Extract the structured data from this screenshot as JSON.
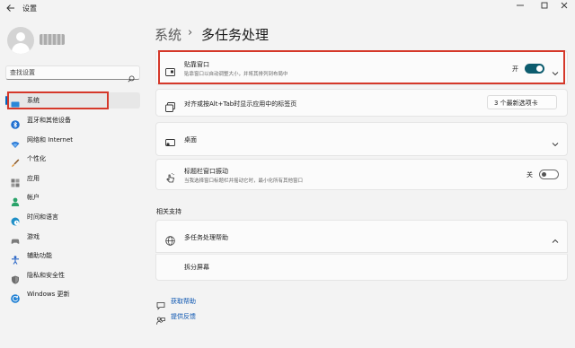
{
  "window": {
    "title": "设置",
    "back_icon": "back-arrow-icon",
    "controls": [
      "minimize-icon",
      "maximize-icon",
      "close-icon"
    ]
  },
  "search": {
    "placeholder": "查找设置"
  },
  "sidebar": {
    "items": [
      {
        "label": "系统",
        "icon": "system-icon",
        "active": true
      },
      {
        "label": "蓝牙和其他设备",
        "icon": "bluetooth-icon"
      },
      {
        "label": "网络和 Internet",
        "icon": "wifi-icon"
      },
      {
        "label": "个性化",
        "icon": "brush-icon"
      },
      {
        "label": "应用",
        "icon": "apps-icon"
      },
      {
        "label": "帐户",
        "icon": "account-icon"
      },
      {
        "label": "时间和语言",
        "icon": "globe-clock-icon"
      },
      {
        "label": "游戏",
        "icon": "gamepad-icon"
      },
      {
        "label": "辅助功能",
        "icon": "accessibility-icon"
      },
      {
        "label": "隐私和安全性",
        "icon": "shield-icon"
      },
      {
        "label": "Windows 更新",
        "icon": "update-icon"
      }
    ]
  },
  "breadcrumb": {
    "parent": "系统",
    "separator": "›",
    "current": "多任务处理"
  },
  "cards": {
    "snap": {
      "title": "贴靠窗口",
      "desc": "贴靠窗口以自动调整大小，并将其排列到布局中",
      "toggle_label": "开",
      "toggle_on": true
    },
    "alt_tab": {
      "title": "对齐或按Alt+Tab时显示应用中的标签页",
      "select_value": "3 个最新选项卡"
    },
    "desktops": {
      "title": "桌面"
    },
    "shake": {
      "title": "标题栏窗口振动",
      "desc": "当我选择窗口标题栏并摇动它时，最小化所有其他窗口",
      "toggle_label": "关",
      "toggle_on": false
    }
  },
  "related": {
    "section_title": "相关支持",
    "help_title": "多任务处理帮助",
    "help_link": "拆分屏幕"
  },
  "footer": {
    "get_help": "获取帮助",
    "feedback": "提供反馈"
  },
  "colors": {
    "accent": "#0067c0",
    "toggle_on": "#0c5c6e",
    "highlight": "#d5382a"
  }
}
